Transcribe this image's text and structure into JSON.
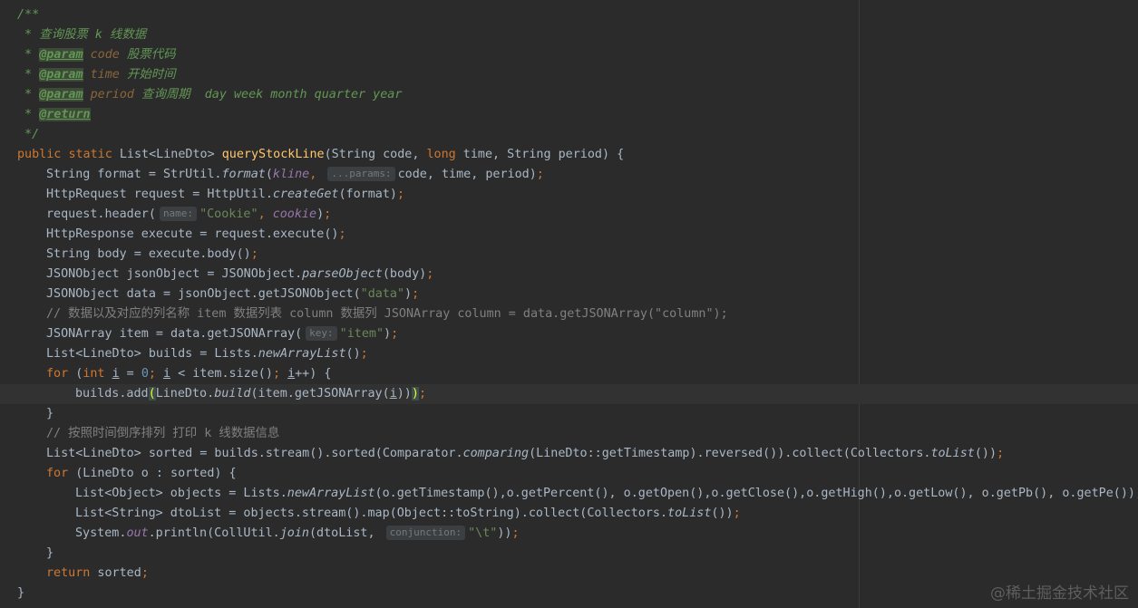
{
  "code": {
    "doc_open": "/**",
    "doc_desc": " * 查询股票 k 线数据",
    "doc_star": " * ",
    "param_tag": "@param",
    "p1_name": "code",
    "p1_desc": " 股票代码",
    "p2_name": "time",
    "p2_desc": " 开始时间",
    "p3_name": "period",
    "p3_desc": " 查询周期  day week month quarter year",
    "return_tag": "@return",
    "doc_close": " */",
    "kw_public": "public",
    "kw_static": "static",
    "ret_type": "List<LineDto>",
    "method_name": "queryStockLine",
    "sig_a": "(String code, ",
    "kw_long": "long",
    "sig_b": " time, String period) {",
    "l3_a": "String format = StrUtil.",
    "l3_fn": "format",
    "l3_b": "(",
    "l3_const": "kline",
    "l3_c": ", ",
    "hint_params": "...params:",
    "l3_d": "code, time, period)",
    "semi": ";",
    "l4_a": "HttpRequest request = HttpUtil.",
    "l4_fn": "createGet",
    "l4_b": "(format)",
    "l5_a": "request.header(",
    "hint_name": "name:",
    "l5_str": "\"Cookie\"",
    "l5_b": ", ",
    "l5_const": "cookie",
    "l5_c": ")",
    "l6": "HttpResponse execute = request.execute()",
    "l7": "String body = execute.body()",
    "l8_a": "JSONObject jsonObject = JSONObject.",
    "l8_fn": "parseObject",
    "l8_b": "(body)",
    "l9_a": "JSONObject data = jsonObject.getJSONObject(",
    "l9_str": "\"data\"",
    "l9_b": ")",
    "l10_comment": "// 数据以及对应的列名称 item 数据列表 column 数据列 JSONArray column = data.getJSONArray(\"column\");",
    "l11_a": "JSONArray item = data.getJSONArray(",
    "hint_key": "key:",
    "l11_str": "\"item\"",
    "l11_b": ")",
    "l12_a": "List<LineDto> builds = Lists.",
    "l12_fn": "newArrayList",
    "l12_b": "()",
    "kw_for": "for",
    "l13_a": " (",
    "kw_int": "int",
    "var_i": "i",
    "l13_eq": " = ",
    "num_zero": "0",
    "l13_lt": " < item.size()",
    "l13_inc": "++) {",
    "l14_a": "builds.add",
    "paren_open": "(",
    "l14_b": "LineDto.",
    "l14_fn": "build",
    "l14_c": "(item.getJSONArray(",
    "l14_d": "))",
    "paren_close": ")",
    "close_brace": "}",
    "l16_comment": "// 按照时间倒序排列 打印 k 线数据信息",
    "l17_a": "List<LineDto> sorted = builds.stream().sorted(Comparator.",
    "l17_fn": "comparing",
    "l17_b": "(LineDto::getTimestamp).reversed()).collect(Collectors.",
    "l17_fn2": "toList",
    "l17_c": "())",
    "l18_b": " (LineDto o : sorted) {",
    "l19_a": "List<Object> objects = Lists.",
    "l19_fn": "newArrayList",
    "l19_b": "(o.getTimestamp(),o.getPercent(), o.getOpen(),o.getClose(),o.getHigh(),o.getLow(), o.getPb(), o.getPe())",
    "l20_a": "List<String> dtoList = objects.stream().map(Object::toString).collect(Collectors.",
    "l20_fn": "toList",
    "l20_b": "())",
    "l21_a": "System.",
    "l21_out": "out",
    "l21_b": ".println(CollUtil.",
    "l21_fn": "join",
    "l21_c": "(dtoList, ",
    "hint_conj": "conjunction:",
    "l21_str": "\"\\t\"",
    "l21_d": "))",
    "kw_return": "return",
    "l23_b": " sorted"
  },
  "watermark": "@稀土掘金技术社区"
}
